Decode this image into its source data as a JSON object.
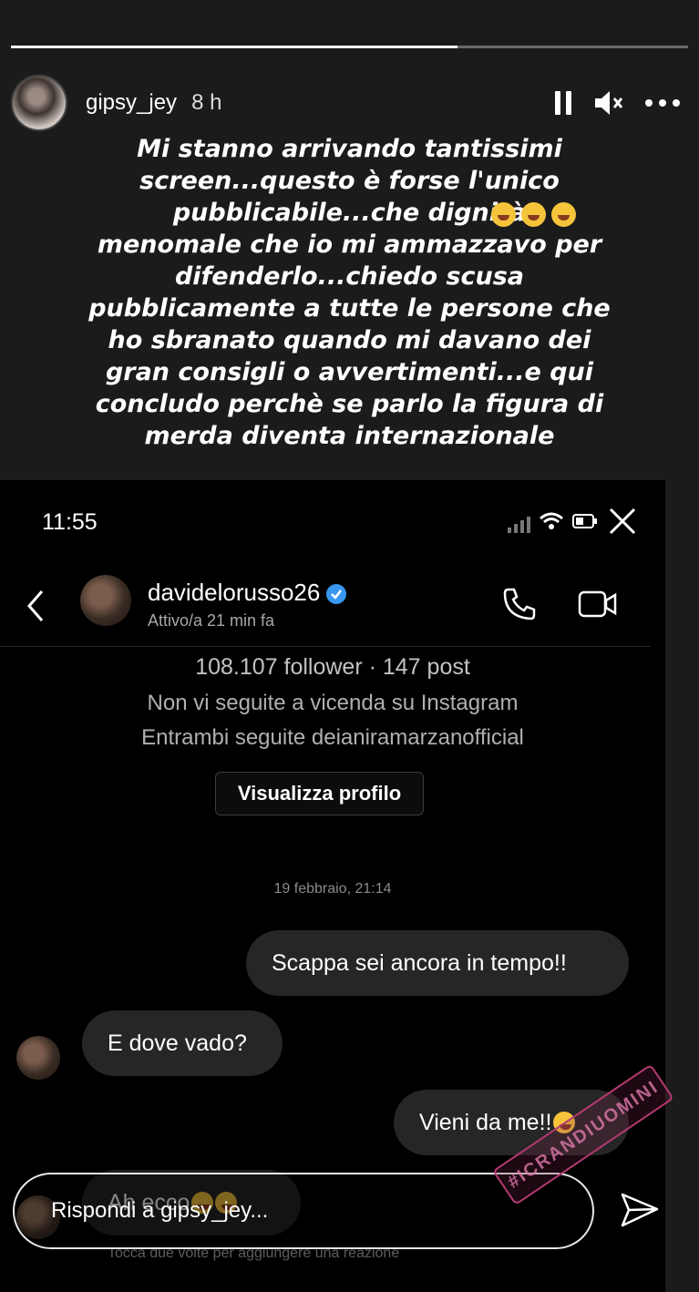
{
  "story": {
    "progress_fraction": 0.66,
    "username": "gipsy_jey",
    "time": "8 h",
    "caption": "Mi stanno arrivando tantissimi\nscreen...questo è forse l'unico\npubblicabile...che dignità\nmenomale che io mi ammazzavo per\ndifenderlo...chiedo scusa\npubblicamente a tutte le persone che\nho sbranato quando mi davano dei\ngran consigli o avvertimenti...e qui\nconcludo perchè se parlo la figura di\nmerda diventa internazionale",
    "caption_emoji_count": 3
  },
  "screenshot": {
    "status_time": "11:55",
    "contact_name": "davidelorusso26",
    "contact_status": "Attivo/a 21 min fa",
    "profile": {
      "followers_line": "108.107 follower · 147 post",
      "mutual_line": "Non vi seguite a vicenda su Instagram",
      "common_line": "Entrambi seguite deianiramarzanofficial",
      "view_button": "Visualizza profilo"
    },
    "date_separator": "19 febbraio, 21:14",
    "messages": [
      {
        "from": "me",
        "text": "Scappa sei ancora in tempo!!"
      },
      {
        "from": "them",
        "text": "E dove vado?"
      },
      {
        "from": "me",
        "text": "Vieni da me!!"
      },
      {
        "from": "them",
        "text": "Ah ecco"
      }
    ],
    "reaction_hint": "Tocca due volte per aggiungere una reazione"
  },
  "reply": {
    "placeholder": "Rispondi a gipsy_jey..."
  },
  "watermark": "#ICRANDIUOMINI",
  "colors": {
    "background": "#1b1b1b",
    "bubble": "#262626",
    "verified": "#3897f0",
    "watermark": "#b23a72"
  }
}
